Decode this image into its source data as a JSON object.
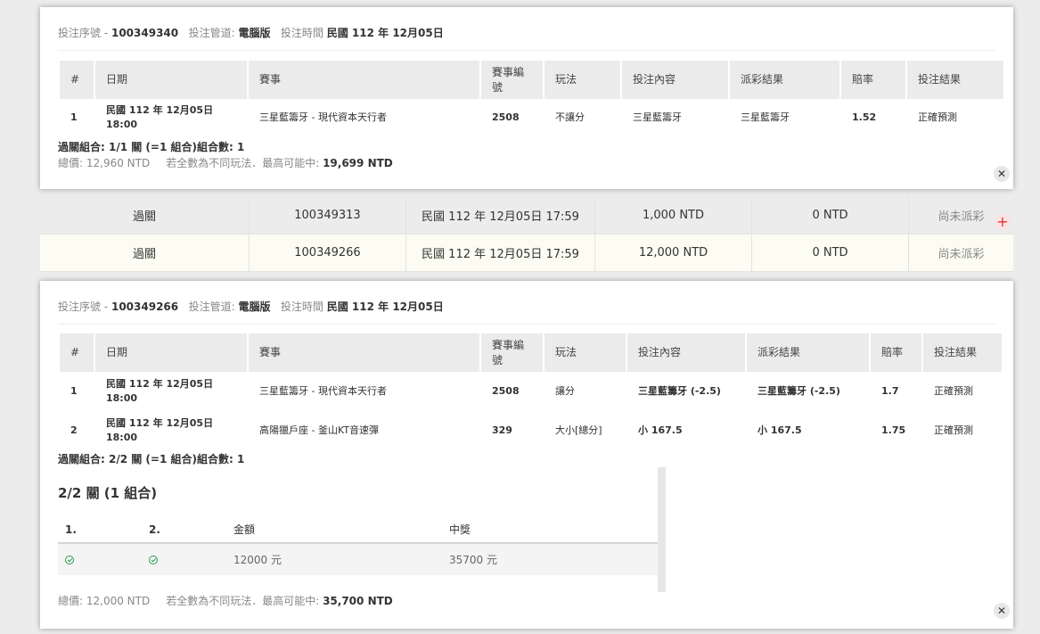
{
  "ticket1": {
    "meta": {
      "serial_label": "投注序號 - ",
      "serial": "100349340",
      "channel_label": "投注管道: ",
      "channel": "電腦版",
      "time_label": "投注時間 ",
      "time": "民國 112 年 12月05日"
    },
    "headers": [
      "#",
      "日期",
      "賽事",
      "賽事編號",
      "玩法",
      "投注內容",
      "派彩結果",
      "賠率",
      "投注結果"
    ],
    "rows": [
      {
        "num": "1",
        "date": "民國 112 年 12月05日",
        "time": "18:00",
        "match": "三星藍籌牙 - 現代資本天行者",
        "match_id": "2508",
        "play": "不讓分",
        "bet": "三星藍籌牙",
        "result": "三星藍籌牙",
        "odds": "1.52",
        "outcome": "正確預測"
      }
    ],
    "combo": "過關組合: 1/1 關 (=1 組合)組合數: 1",
    "total_label": "總價: ",
    "total": "12,960 NTD",
    "note": "若全數為不同玩法．最高可能中: ",
    "max_win": "19,699 NTD",
    "close": "✕"
  },
  "summary_rows": [
    {
      "type": "過關",
      "serial": "100349313",
      "time": "民國 112 年 12月05日 17:59",
      "amount": "1,000 NTD",
      "payout": "0 NTD",
      "status": "尚未派彩",
      "action": "+"
    },
    {
      "type": "過關",
      "serial": "100349266",
      "time": "民國 112 年 12月05日 17:59",
      "amount": "12,000 NTD",
      "payout": "0 NTD",
      "status": "尚未派彩"
    }
  ],
  "ticket2": {
    "meta": {
      "serial_label": "投注序號 - ",
      "serial": "100349266",
      "channel_label": "投注管道: ",
      "channel": "電腦版",
      "time_label": "投注時間 ",
      "time": "民國 112 年 12月05日"
    },
    "headers": [
      "#",
      "日期",
      "賽事",
      "賽事編號",
      "玩法",
      "投注內容",
      "派彩結果",
      "賠率",
      "投注結果"
    ],
    "rows": [
      {
        "num": "1",
        "date": "民國 112 年 12月05日",
        "time": "18:00",
        "match": "三星藍籌牙 - 現代資本天行者",
        "match_id": "2508",
        "play": "讓分",
        "bet": "三星藍籌牙 (-2.5)",
        "result": "三星藍籌牙 (-2.5)",
        "odds": "1.7",
        "outcome": "正確預測"
      },
      {
        "num": "2",
        "date": "民國 112 年 12月05日",
        "time": "18:00",
        "match": "高陽獵戶座 - 釜山KT音速彈",
        "match_id": "329",
        "play": "大小[總分]",
        "bet": "小 167.5",
        "result": "小 167.5",
        "odds": "1.75",
        "outcome": "正確預測"
      }
    ],
    "combo": "過關組合: 2/2 關 (=1 組合)組合數: 1",
    "sub": {
      "title": "2/2 關 (1 組合)",
      "headers": [
        "1.",
        "2.",
        "金額",
        "中獎"
      ],
      "amount": "12000 元",
      "prize": "35700 元"
    },
    "total_label": "總價: ",
    "total": "12,000 NTD",
    "note": "若全數為不同玩法．最高可能中: ",
    "max_win": "35,700 NTD",
    "close": "✕"
  }
}
